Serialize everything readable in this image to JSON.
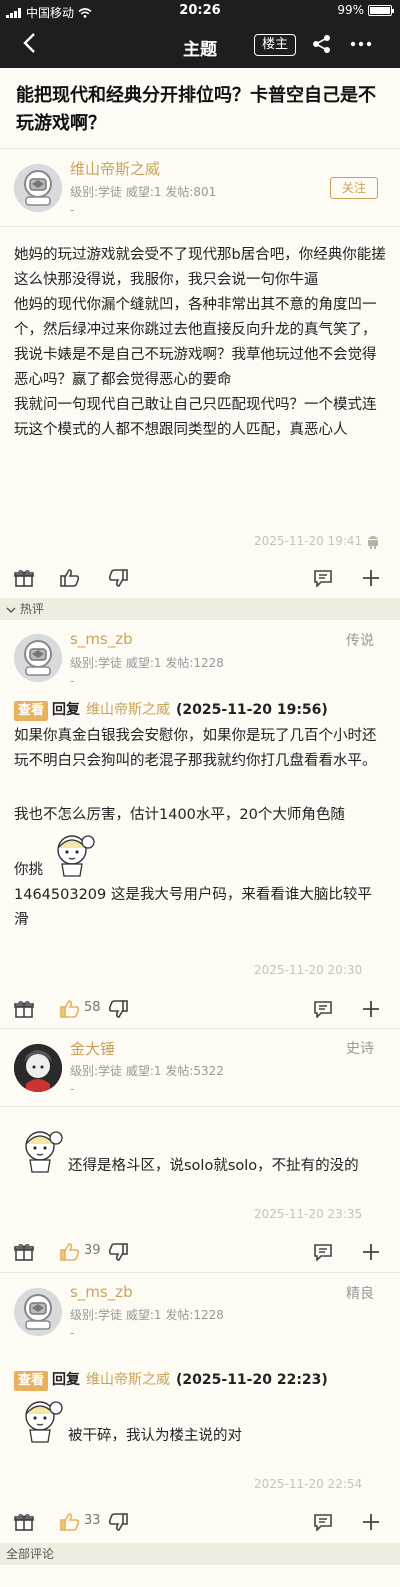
{
  "status_bar": {
    "carrier": "中国移动",
    "time": "20:26",
    "battery": "99%",
    "battery_level": 0.99
  },
  "nav": {
    "title": "主题",
    "owner_button": "楼主"
  },
  "post": {
    "title": "能把现代和经典分开排位吗？卡普空自己是不玩游戏啊？",
    "author": "维山帝斯之威",
    "meta": "级别:学徒   威望:1   发帖:801",
    "dash": "-",
    "follow_label": "关注",
    "paragraphs": [
      "她妈的玩过游戏就会受不了现代那b居合吧，你经典你能搓这么快那没得说，我服你，我只会说一句你牛逼",
      "他妈的现代你漏个缝就凹，各种非常出其不意的角度凹一个，然后绿冲过来你跳过去他直接反向升龙的真气笑了，我说卡婊是不是自己不玩游戏啊？我草他玩过他不会觉得恶心吗？赢了都会觉得恶心的要命",
      "我就问一句现代自己敢让自己只匹配现代吗？一个模式连玩这个模式的人都不想跟同类型的人匹配，真恶心人"
    ],
    "timestamp": "2025-11-20 19:41"
  },
  "hot_label": "热评",
  "all_label": "全部评论",
  "comments": [
    {
      "username": "s_ms_zb",
      "rank": "传说",
      "meta": "级别:学徒   威望:1   发帖:1228",
      "dash": "-",
      "look_tag": "查看",
      "reply_word": "回复",
      "reply_to": "维山帝斯之威",
      "reply_time": "(2025-11-20 19:56)",
      "text1": "如果你真金白银我会安慰你，如果你是玩了几百个小时还玩不明白只会狗叫的老混子那我就约你打几盘看看水平。",
      "text2": "我也不怎么厉害，估计1400水平，20个大师角色随",
      "text3": "你挑",
      "text4": "1464503209 这是我大号用户码，来看看谁大脑比较平滑",
      "timestamp": "2025-11-20 20:30",
      "likes": "58"
    },
    {
      "username": "金大锤",
      "rank": "史诗",
      "meta": "级别:学徒   威望:1   发帖:5322",
      "dash": "-",
      "text1": "还得是格斗区，说solo就solo，不扯有的没的",
      "timestamp": "2025-11-20 23:35",
      "likes": "39"
    },
    {
      "username": "s_ms_zb",
      "rank": "精良",
      "meta": "级别:学徒   威望:1   发帖:1228",
      "dash": "-",
      "look_tag": "查看",
      "reply_word": "回复",
      "reply_to": "维山帝斯之威",
      "reply_time": "(2025-11-20 22:23)",
      "text1": "被干碎，我认为楼主说的对",
      "timestamp": "2025-11-20 22:54",
      "likes": "33"
    }
  ],
  "icons": {
    "gift": "gift-icon",
    "like": "thumbs-up-icon",
    "dislike": "thumbs-down-icon",
    "comment": "comment-icon",
    "add": "plus-icon"
  },
  "colors": {
    "accent": "#c8a45a",
    "look_tag": "#e8b15e",
    "bar": "#1e1e1e"
  }
}
